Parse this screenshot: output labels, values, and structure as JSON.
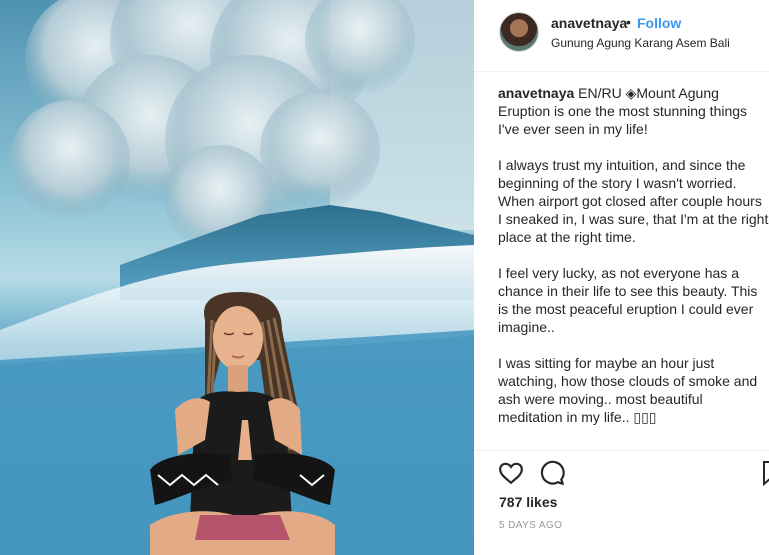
{
  "post": {
    "username": "anavetnaya",
    "separator": "•",
    "follow_label": "Follow",
    "location": "Gunung Agung Karang Asem Bali",
    "caption": {
      "username": "anavetnaya",
      "first_line": "EN/RU ◈Mount Agung Eruption is one the most stunning things I've ever seen in my life!",
      "paragraphs": [
        "I always trust my intuition, and since the beginning of the story I wasn't worried. When airport got closed after couple hours I sneaked in, I was sure, that I'm at the right place at the right time.",
        "I feel very lucky, as not everyone has a chance in their life to see this beauty. This is the most peaceful eruption I could ever imagine..",
        "I was sitting for maybe an hour just watching, how those clouds of smoke and ash were moving.. most beautiful meditation in my life.. ▯▯▯"
      ]
    },
    "likes": "787 likes",
    "time": "5 DAYS AGO"
  },
  "icons": {
    "like": "heart-icon",
    "comment": "comment-bubble-icon",
    "save": "bookmark-icon"
  }
}
